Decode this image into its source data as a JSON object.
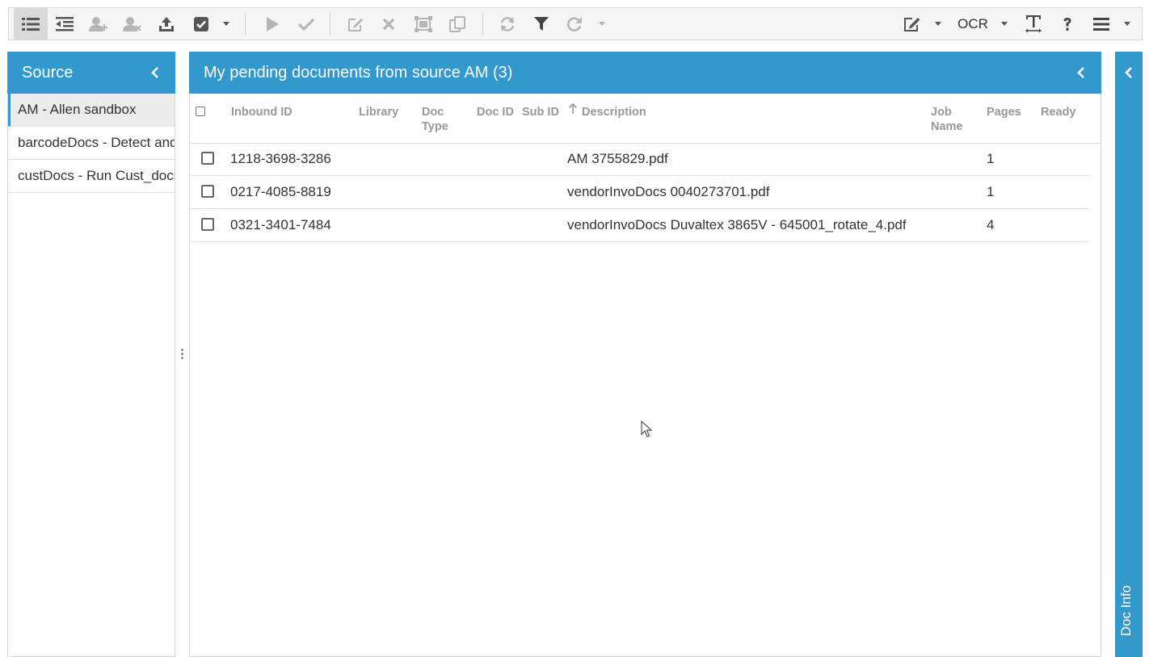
{
  "toolbar": {
    "ocr_label": "OCR"
  },
  "source_panel": {
    "title": "Source",
    "items": [
      {
        "label": "AM - Allen sandbox",
        "selected": true
      },
      {
        "label": "barcodeDocs - Detect and split",
        "selected": false
      },
      {
        "label": "custDocs - Run Cust_docs",
        "selected": false
      }
    ]
  },
  "main_panel": {
    "title": "My pending documents from source AM (3)",
    "columns": {
      "inbound_id": "Inbound ID",
      "library": "Library",
      "doc_type_1": "Doc",
      "doc_type_2": "Type",
      "doc_id": "Doc ID",
      "sub_id": "Sub ID",
      "description": "Description",
      "job_name_1": "Job",
      "job_name_2": "Name",
      "pages": "Pages",
      "ready": "Ready"
    },
    "rows": [
      {
        "inbound_id": "1218-3698-3286",
        "description": "AM 3755829.pdf",
        "pages": "1"
      },
      {
        "inbound_id": "0217-4085-8819",
        "description": "vendorInvoDocs 0040273701.pdf",
        "pages": "1"
      },
      {
        "inbound_id": "0321-3401-7484",
        "description": "vendorInvoDocs Duvaltex 3865V - 645001_rotate_4.pdf",
        "pages": "4"
      }
    ]
  },
  "doc_info": {
    "label": "Doc Info"
  },
  "colors": {
    "accent": "#3399cc",
    "toolbar_bg": "#f5f5f5"
  }
}
